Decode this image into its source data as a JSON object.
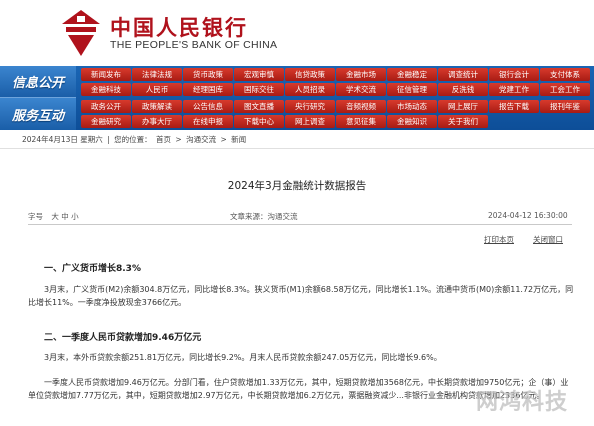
{
  "header": {
    "title_cn": "中国人民银行",
    "title_en": "THE PEOPLE'S BANK OF CHINA",
    "brand_color": "#b0121c"
  },
  "nav": {
    "row1_label": "信息公开",
    "row2_label": "服务互动",
    "row1": [
      "新闻发布",
      "法律法规",
      "货币政策",
      "宏观审慎",
      "信贷政策",
      "金融市场",
      "金融稳定",
      "调查统计",
      "银行会计",
      "支付体系"
    ],
    "row2": [
      "金融科技",
      "人民币",
      "经理国库",
      "国际交往",
      "人员招录",
      "学术交流",
      "征信管理",
      "反洗钱",
      "党建工作",
      "工会工作"
    ],
    "row3": [
      "政务公开",
      "政策解读",
      "公告信息",
      "图文直播",
      "央行研究",
      "音频视频",
      "市场动态",
      "网上展厅",
      "报告下载",
      "报刊年鉴"
    ],
    "row4": [
      "金融研究",
      "办事大厅",
      "在线申报",
      "下载中心",
      "网上调查",
      "意见征集",
      "金融知识",
      "关于我们"
    ]
  },
  "breadcrumb": [
    "2024年4月13日 星期六",
    "|",
    "您的位置：",
    "首页",
    "沟通交流",
    "新闻"
  ],
  "article": {
    "title": "2024年3月金融统计数据报告",
    "font_size_label": "字号",
    "font_sizes": "大 中 小",
    "source": "文章来源：沟通交流",
    "date": "2024-04-12 16:30:00",
    "print_label": "打印本页",
    "close_label": "关闭窗口",
    "sections": [
      {
        "heading": "一、广义货币增长8.3%",
        "paragraph": "3月末，广义货币(M2)余额304.8万亿元，同比增长8.3%。狭义货币(M1)余额68.58万亿元，同比增长1.1%。流通中货币(M0)余额11.72万亿元，同比增长11%。一季度净投放现金3766亿元。"
      },
      {
        "heading": "二、一季度人民币贷款增加9.46万亿元",
        "paragraph": "3月末，本外币贷款余额251.81万亿元，同比增长9.2%。月末人民币贷款余额247.05万亿元，同比增长9.6%。",
        "paragraph2": "一季度人民币贷款增加9.46万亿元。分部门看，住户贷款增加1.33万亿元，其中，短期贷款增加3568亿元，中长期贷款增加9750亿元；企（事）业单位贷款增加7.77万亿元，其中，短期贷款增加2.97万亿元，中长期贷款增加6.2万亿元，票据融资减少...非银行业金融机构贷款增加2336亿元。"
      }
    ]
  },
  "watermark": "网鸿科技"
}
